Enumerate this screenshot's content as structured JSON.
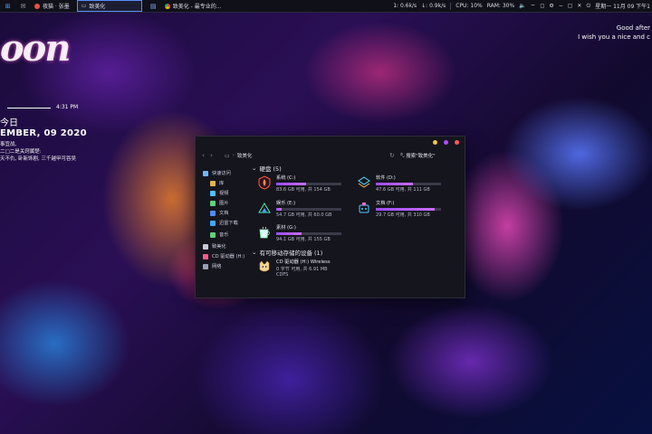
{
  "taskbar": {
    "tasks": [
      {
        "label": "夜猫 · 张墨"
      },
      {
        "label": "致美化"
      },
      {
        "label": "致美化 - 最专业的..."
      }
    ],
    "net_down": "1: 0.6k/s",
    "net_up": "↓: 0.9k/s",
    "cpu": "CPU: 10%",
    "ram": "RAM: 30%",
    "datetime": "星期一 11月 09 下午1"
  },
  "desktop": {
    "script_text": "oon",
    "clock_time": "4:31 PM",
    "today_label": "今日",
    "date_text": "EMBER, 09 2020",
    "quote_lines": [
      "事宜战,",
      "二□二是关窍属楚:",
      "天不仇, 卧新饰剧, 三千越甲可吞吴"
    ],
    "greeting_lines": [
      "Good after",
      "I wish you a nice and c"
    ]
  },
  "explorer": {
    "breadcrumb": "致美化",
    "search_placeholder": "搜索\"致美化\"",
    "sidebar": [
      {
        "label": "快速访问",
        "icon": "star-icon",
        "color": "#6fb6ff",
        "sub": false
      },
      {
        "label": "库",
        "icon": "library-icon",
        "color": "#e6b34a",
        "sub": true
      },
      {
        "label": "视频",
        "icon": "video-icon",
        "color": "#4ec0ff",
        "sub": true
      },
      {
        "label": "图片",
        "icon": "picture-icon",
        "color": "#5fd27a",
        "sub": true
      },
      {
        "label": "文档",
        "icon": "document-icon",
        "color": "#4e8bff",
        "sub": true
      },
      {
        "label": "迅雷下载",
        "icon": "download-icon",
        "color": "#3fa7ff",
        "sub": true
      },
      {
        "label": "音乐",
        "icon": "music-icon",
        "color": "#5fd27a",
        "sub": true
      },
      {
        "label": "致美化",
        "icon": "computer-icon",
        "color": "#c9c9d8",
        "sub": false
      },
      {
        "label": "CD 驱动器 (H:)",
        "icon": "cd-icon",
        "color": "#ff5a8a",
        "sub": false
      },
      {
        "label": "网络",
        "icon": "network-icon",
        "color": "#9aa0b8",
        "sub": false
      }
    ],
    "drives_header": "硬盘 (5)",
    "drives": [
      {
        "name": "系统 (C:)",
        "free": "83.6 GB 可用, 共 154 GB",
        "used_fraction": 0.46,
        "icon": "shield-drive-icon",
        "icon_color": "#ff5a3c"
      },
      {
        "name": "软件 (D:)",
        "free": "47.6 GB 可用, 共 111 GB",
        "used_fraction": 0.57,
        "icon": "layers-drive-icon",
        "icon_color": "#4ee0ff"
      },
      {
        "name": "娱乐 (E:)",
        "free": "54.7 GB 可用, 共 60.0 GB",
        "used_fraction": 0.09,
        "icon": "mountain-drive-icon",
        "icon_color": "#4ef0a0"
      },
      {
        "name": "文档 (F:)",
        "free": "29.7 GB 可用, 共 310 GB",
        "used_fraction": 0.9,
        "icon": "robot-drive-icon",
        "icon_color": "#4ec8ff"
      },
      {
        "name": "素材 (G:)",
        "free": "94.1 GB 可用, 共 155 GB",
        "used_fraction": 0.39,
        "icon": "cup-drive-icon",
        "icon_color": "#8af0a0"
      }
    ],
    "removable_header": "有可移动存储的设备 (1)",
    "removable": {
      "name": "CD 驱动器 (H:) Wireless",
      "free": "0 字节 可用, 共 6.91 MB",
      "fs": "CDFS",
      "icon": "cd-drive-icon"
    }
  }
}
